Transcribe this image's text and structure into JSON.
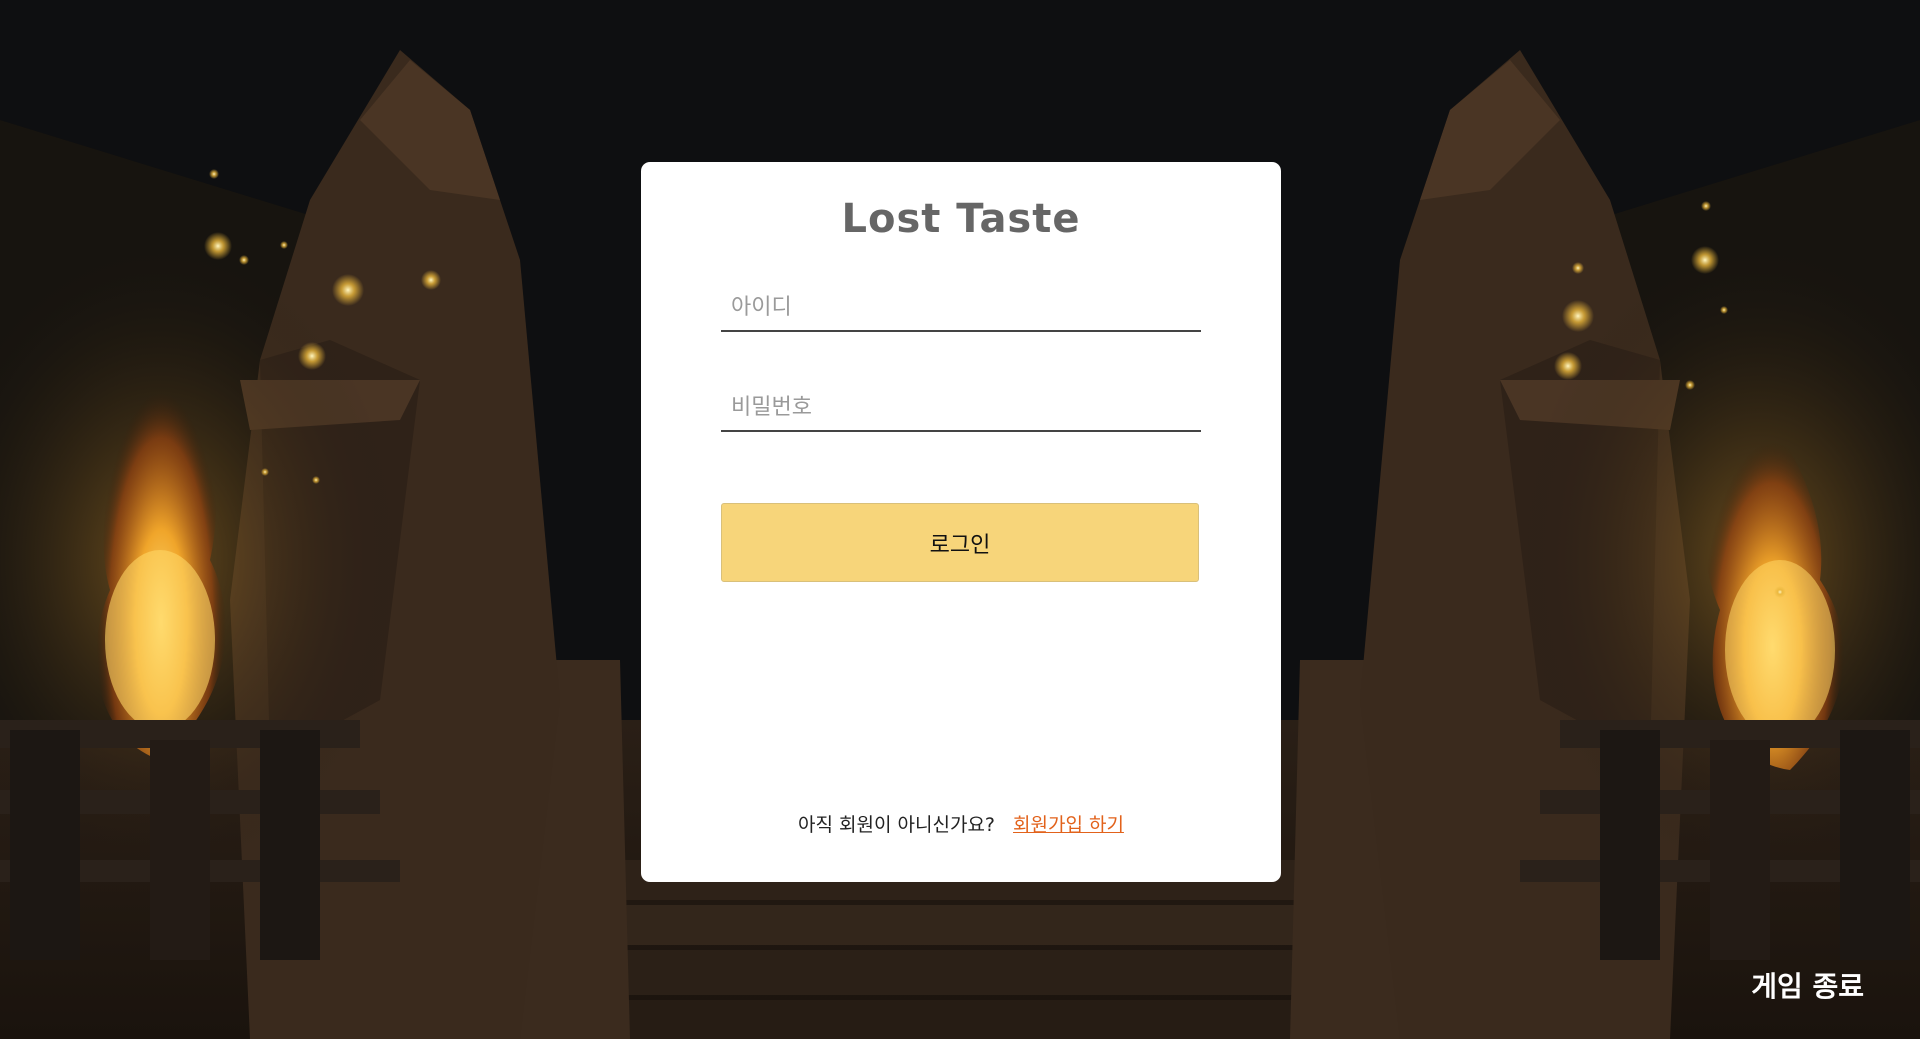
{
  "login": {
    "title": "Lost Taste",
    "id_placeholder": "아이디",
    "password_placeholder": "비밀번호",
    "login_label": "로그인",
    "signup_prompt": "아직 회원이 아니신가요?",
    "signup_link": "회원가입 하기"
  },
  "footer": {
    "exit_label": "게임 종료"
  },
  "colors": {
    "button_bg": "#f7d57a",
    "link": "#e2621b",
    "title": "#666666"
  }
}
